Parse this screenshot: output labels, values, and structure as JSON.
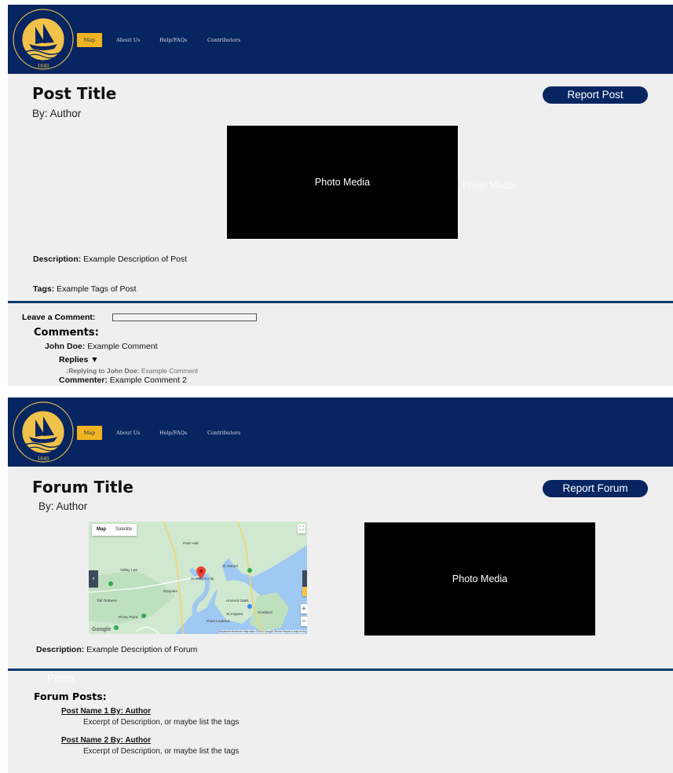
{
  "nav": {
    "map_label": "Map",
    "about_label": "About Us",
    "help_label": "Help/FAQs",
    "contributors_label": "Contributors",
    "brand_color": "#062561",
    "accent_color": "#f1b420",
    "logo_text": "ST. MARY'S COLLEGE OF MARYLAND 1840"
  },
  "post_page": {
    "title": "Post Title",
    "byline": "By: Author",
    "report_label": "Report Post",
    "photo_label": "Photo Media",
    "ghost_photo_label": "Photo Media",
    "description_label": "Description:",
    "description_text": " Example Description of Post",
    "tags_label": "Tags:",
    "tags_text": " Example Tags of Post",
    "leave_comment_label": "Leave a Comment:",
    "comments_heading": "Comments:",
    "comments": [
      {
        "author": "John Doe:",
        "text": " Example Comment"
      },
      {
        "author": "Commenter:",
        "text": " Example Comment 2"
      }
    ],
    "replies_label": "Replies",
    "reply": {
      "author": "Replying to John Doe:",
      "text": " Example Comment"
    }
  },
  "forum_page": {
    "title": "Forum Title",
    "byline": "By: Author",
    "report_label": "Report Forum",
    "photo_label": "Photo Media",
    "description_label": "Description:",
    "description_text": " Example Description of Forum",
    "ghost_label": "Posts",
    "posts_heading": "Forum Posts:",
    "posts": [
      {
        "title": "Post Name 1 By: Author",
        "excerpt": "Excerpt of Description, or maybe list the tags"
      },
      {
        "title": "Post Name 2 By: Author",
        "excerpt": "Excerpt of Description, or maybe list the tags"
      }
    ],
    "map": {
      "tab_map": "Map",
      "tab_satellite": "Satellite",
      "labels": {
        "park_hall": "Park Hall",
        "valley_lee": "Valley Lee",
        "st_james": "St James",
        "piney_point": "Piney Point",
        "st_marys_city": "St Mary's City",
        "drayden": "Drayden",
        "tall_timbers": "Tall Timbers",
        "ancient_oaks": "Ancient Oaks",
        "st_inigoes": "St Inigoes",
        "scotland": "Scotland",
        "point_lookout": "Point Lookout"
      },
      "footer": "Keyboard shortcuts   Map data ©2024 Google   Terms   Report a map error",
      "google": "Google"
    }
  }
}
